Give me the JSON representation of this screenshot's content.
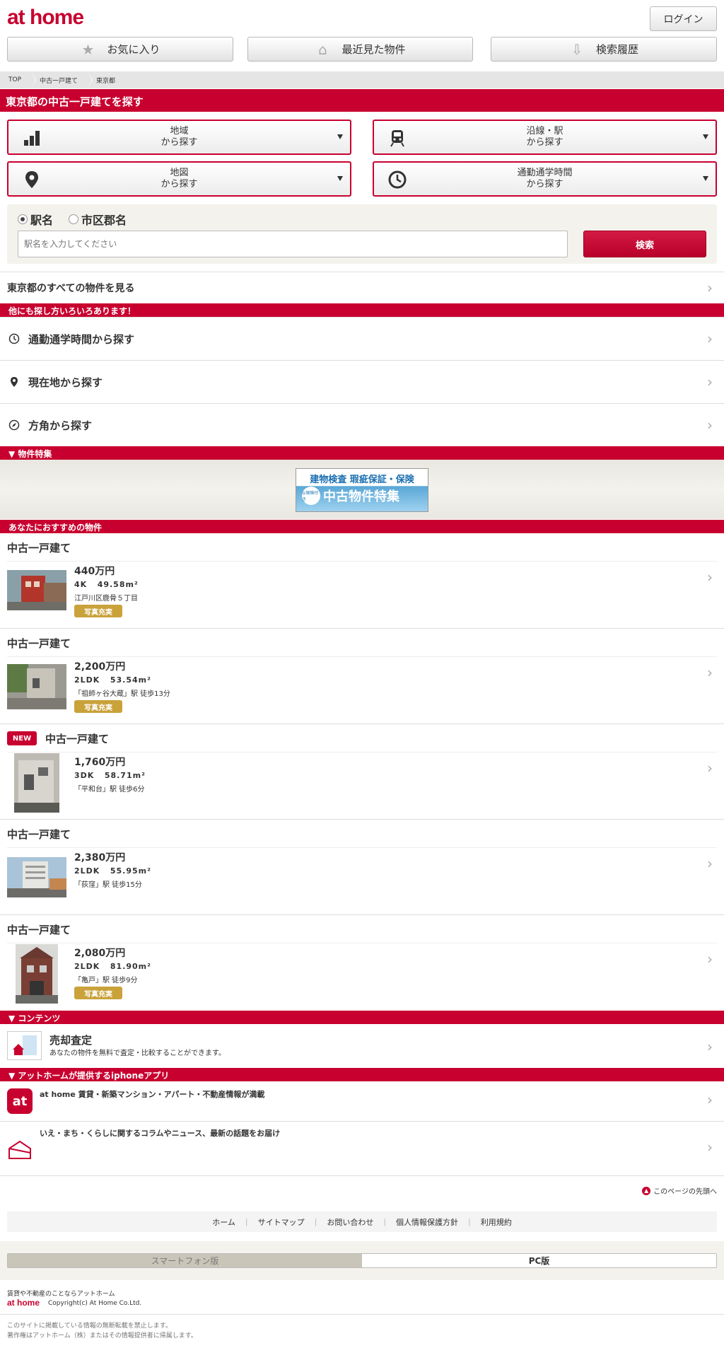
{
  "header": {
    "logo": "at home",
    "login": "ログイン",
    "favorites": "お気に入り",
    "recent": "最近見た物件",
    "history": "検索履歴"
  },
  "breadcrumb": [
    "TOP",
    "中古一戸建て",
    "東京都"
  ],
  "page_title": "東京都の中古一戸建てを探す",
  "search_buttons": [
    {
      "line1": "地域",
      "line2": "から探す",
      "icon": "area-icon"
    },
    {
      "line1": "沿線・駅",
      "line2": "から探す",
      "icon": "train-icon"
    },
    {
      "line1": "地図",
      "line2": "から探す",
      "icon": "map-pin-icon"
    },
    {
      "line1": "通勤通学時間",
      "line2": "から探す",
      "icon": "clock-icon"
    }
  ],
  "station_search": {
    "radio_station": "駅名",
    "radio_city": "市区郡名",
    "placeholder": "駅名を入力してください",
    "button": "検索"
  },
  "all_properties": "東京都のすべての物件を見る",
  "other_ways": {
    "title": "他にも探し方いろいろあります！",
    "items": [
      "通勤通学時間から探す",
      "現在地から探す",
      "方角から探す"
    ]
  },
  "feature": {
    "title": "▼ 物件特集",
    "banner_top": "建物検査 瑕疵保証・保険",
    "banner_main": "中古物件特集",
    "banner_badge": "◎保険付き"
  },
  "recommended": {
    "title": "あなたにおすすめの物件",
    "badge_photo": "写真充実",
    "badge_new": "NEW",
    "items": [
      {
        "type": "中古一戸建て",
        "price": "440万円",
        "layout": "4K",
        "area": "49.58m²",
        "location": "江戸川区鹿骨５丁目",
        "photo": true,
        "new": false
      },
      {
        "type": "中古一戸建て",
        "price": "2,200万円",
        "layout": "2LDK",
        "area": "53.54m²",
        "location": "「祖師ヶ谷大蔵」駅 徒歩13分",
        "photo": true,
        "new": false
      },
      {
        "type": "中古一戸建て",
        "price": "1,760万円",
        "layout": "3DK",
        "area": "58.71m²",
        "location": "「平和台」駅 徒歩6分",
        "photo": false,
        "new": true
      },
      {
        "type": "中古一戸建て",
        "price": "2,380万円",
        "layout": "2LDK",
        "area": "55.95m²",
        "location": "「荻窪」駅 徒歩15分",
        "photo": false,
        "new": false
      },
      {
        "type": "中古一戸建て",
        "price": "2,080万円",
        "layout": "2LDK",
        "area": "81.90m²",
        "location": "「亀戸」駅 徒歩9分",
        "photo": true,
        "new": false
      }
    ]
  },
  "contents": {
    "title": "▼ コンテンツ",
    "item_title": "売却査定",
    "item_desc": "あなたの物件を無料で査定・比較することができます。"
  },
  "apps": {
    "title": "▼ アットホームが提供するiphoneアプリ",
    "app1": "at home 賃貸・新築マンション・アパート・不動産情報が満載",
    "app2": "いえ・まち・くらしに関するコラムやニュース、最新の話題をお届け"
  },
  "footer": {
    "page_top": "このページの先頭へ",
    "nav": [
      "ホーム",
      "サイトマップ",
      "お問い合わせ",
      "個人情報保護方針",
      "利用規約"
    ],
    "smartphone": "スマートフォン版",
    "pc": "PC版",
    "tagline": "賃貸や不動産のことならアットホーム",
    "logo": "at home",
    "copyright": "Copyright(c) At Home Co.Ltd.",
    "note1": "このサイトに掲載している情報の無断転載を禁止します。",
    "note2": "著作権はアットホーム（株）またはその情報提供者に帰属します。"
  },
  "colors": {
    "brand": "#c8002f",
    "photo_badge": "#c9a23a"
  }
}
